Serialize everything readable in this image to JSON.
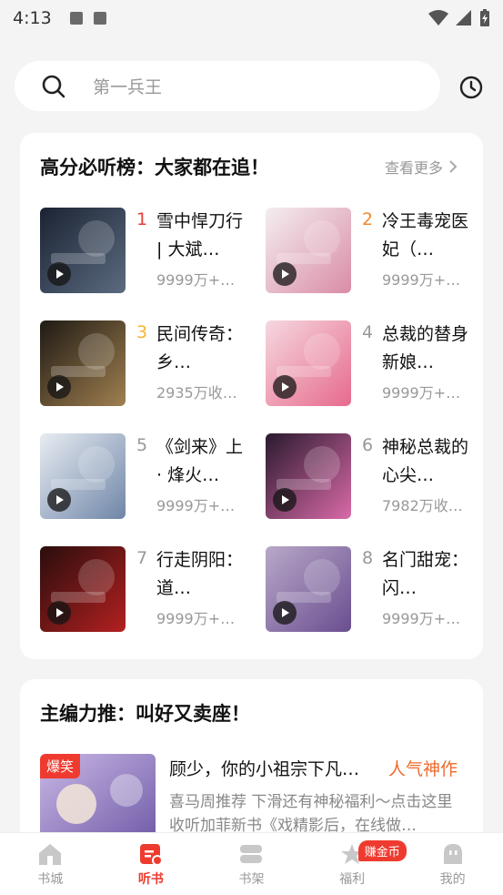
{
  "status_bar": {
    "time": "4:13"
  },
  "search": {
    "placeholder": "第一兵王"
  },
  "rank_section": {
    "title": "高分必听榜：大家都在追！",
    "more_label": "查看更多",
    "items": [
      {
        "rank": "1",
        "title": "雪中悍刀行 | 大斌…",
        "meta": "9999万+…",
        "cover_colors": [
          "#1b2333",
          "#5b6b80"
        ]
      },
      {
        "rank": "2",
        "title": "冷王毒宠医妃（…",
        "meta": "9999万+…",
        "cover_colors": [
          "#f4eef0",
          "#d98ca5"
        ]
      },
      {
        "rank": "3",
        "title": "民间传奇：乡…",
        "meta": "2935万收…",
        "cover_colors": [
          "#1f1a14",
          "#a08050"
        ]
      },
      {
        "rank": "4",
        "title": "总裁的替身新娘…",
        "meta": "9999万+…",
        "cover_colors": [
          "#f6d8e0",
          "#e66a8c"
        ]
      },
      {
        "rank": "5",
        "title": "《剑来》上 · 烽火…",
        "meta": "9999万+…",
        "cover_colors": [
          "#e8ecf2",
          "#6f86a8"
        ]
      },
      {
        "rank": "6",
        "title": "神秘总裁的心尖…",
        "meta": "7982万收…",
        "cover_colors": [
          "#2a1a2e",
          "#d96aa8"
        ]
      },
      {
        "rank": "7",
        "title": "行走阴阳：道…",
        "meta": "9999万+…",
        "cover_colors": [
          "#2a0d0d",
          "#b32020"
        ]
      },
      {
        "rank": "8",
        "title": "名门甜宠：闪…",
        "meta": "9999万+…",
        "cover_colors": [
          "#b8a8c8",
          "#6a4e90"
        ]
      }
    ]
  },
  "rec_section": {
    "title": "主编力推：叫好又卖座！",
    "item": {
      "badge": "爆笑",
      "title": "顾少，你的小祖宗下凡…",
      "tag": "人气神作",
      "desc": "喜马周推荐 下滑还有神秘福利～点击这里收听加菲新书《戏精影后，在线做…"
    }
  },
  "tab_bar": {
    "tabs": [
      {
        "label": "书城",
        "icon": "home-icon"
      },
      {
        "label": "听书",
        "icon": "listen-icon"
      },
      {
        "label": "书架",
        "icon": "bookshelf-icon"
      },
      {
        "label": "福利",
        "icon": "gift-icon"
      },
      {
        "label": "我的",
        "icon": "profile-icon"
      }
    ],
    "active": "听书",
    "earn_badge": "赚金币"
  },
  "colors": {
    "accent": "#ef3b2f",
    "tag": "#ef6a2c"
  }
}
